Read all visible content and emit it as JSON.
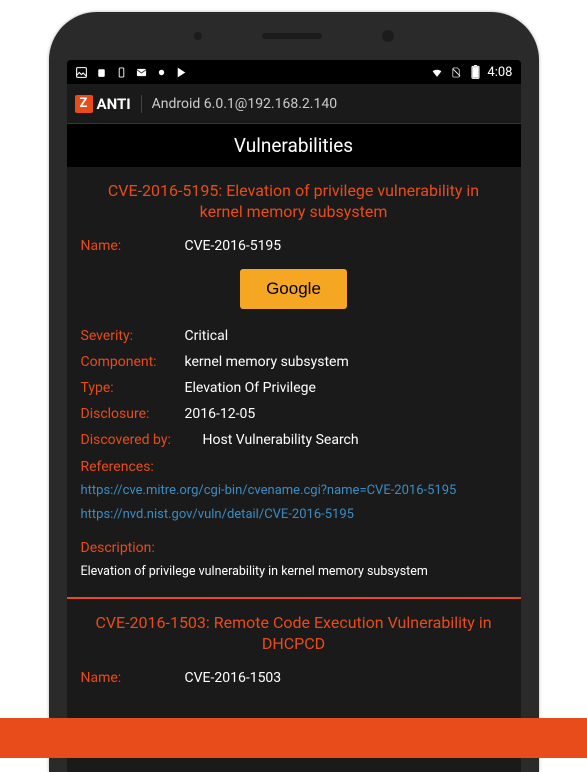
{
  "statusBar": {
    "time": "4:08"
  },
  "appHeader": {
    "brand": "ANTI",
    "target": "Android 6.0.1@192.168.2.140"
  },
  "sectionTitle": "Vulnerabilities",
  "vulnerabilities": [
    {
      "title": "CVE-2016-5195: Elevation of privilege vulnerability in kernel memory subsystem",
      "nameLabel": "Name:",
      "name": "CVE-2016-5195",
      "googleBtn": "Google",
      "severityLabel": "Severity:",
      "severity": "Critical",
      "componentLabel": "Component:",
      "component": "kernel memory subsystem",
      "typeLabel": "Type:",
      "type": "Elevation Of Privilege",
      "disclosureLabel": "Disclosure:",
      "disclosure": "2016-12-05",
      "discoveredByLabel": "Discovered by:",
      "discoveredBy": "Host Vulnerability Search",
      "referencesLabel": "References:",
      "references": [
        "https://cve.mitre.org/cgi-bin/cvename.cgi?name=CVE-2016-5195",
        "https://nvd.nist.gov/vuln/detail/CVE-2016-5195"
      ],
      "descriptionLabel": "Description:",
      "description": "Elevation of privilege vulnerability in kernel memory subsystem"
    },
    {
      "title": "CVE-2016-1503: Remote Code Execution Vulnerability in DHCPCD",
      "nameLabel": "Name:",
      "name": "CVE-2016-1503"
    }
  ]
}
